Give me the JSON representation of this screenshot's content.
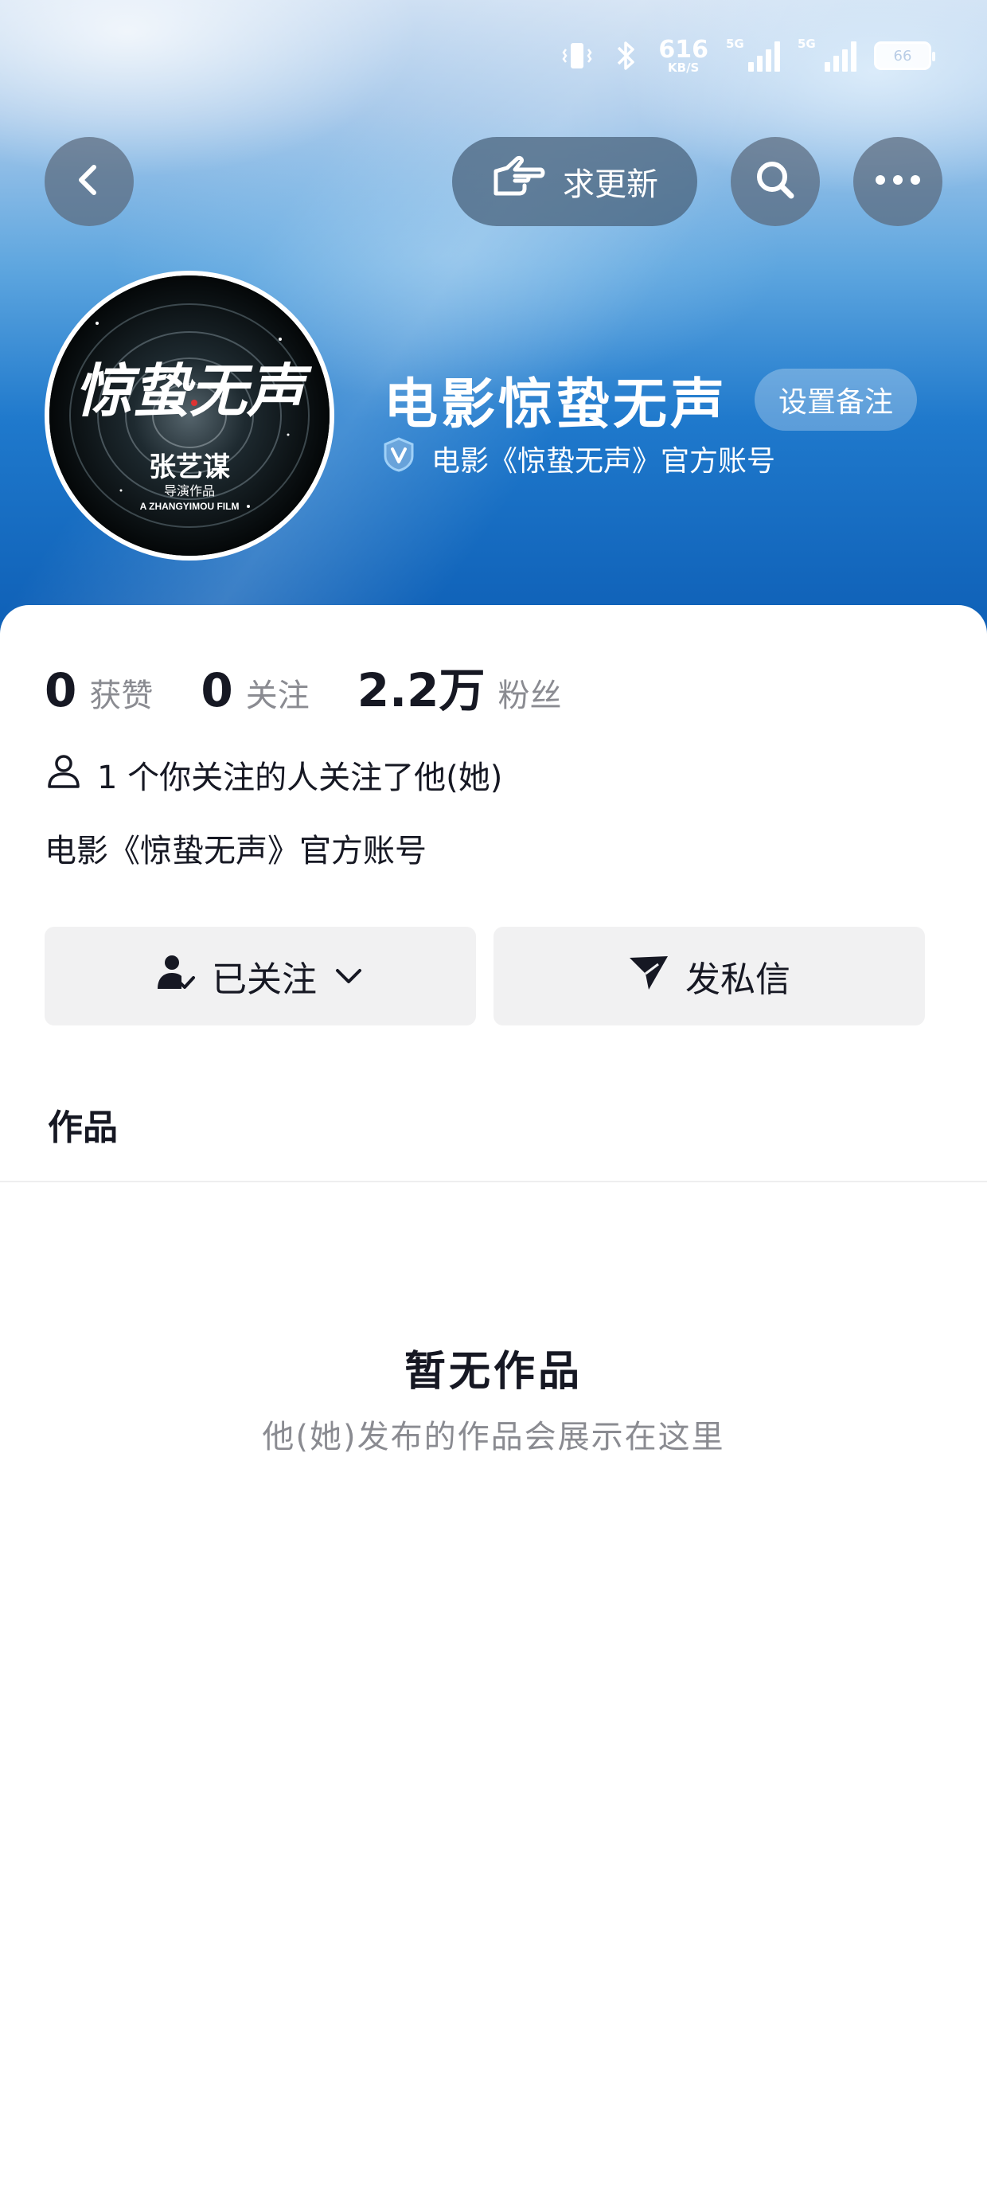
{
  "status_bar": {
    "net_speed": "616",
    "net_unit": "KB/S",
    "sim1_label": "5G",
    "sim2_label": "5G",
    "battery": "66"
  },
  "nav": {
    "back_icon": "chevron-left-icon",
    "request_update_label": "求更新",
    "request_update_icon": "pointing-hand-icon",
    "search_icon": "search-icon",
    "more_icon": "more-dots-icon"
  },
  "profile": {
    "name": "电影惊蛰无声",
    "remark_button": "设置备注",
    "verified_text": "电影《惊蛰无声》官方账号",
    "avatar_texts": {
      "title": "惊蛰无声",
      "director": "张艺谋",
      "sub": "导演作品",
      "en": "A ZHANGYIMOU FILM"
    }
  },
  "stats": [
    {
      "value": "0",
      "label": "获赞"
    },
    {
      "value": "0",
      "label": "关注"
    },
    {
      "value": "2.2万",
      "label": "粉丝"
    }
  ],
  "mutual_follow": "1 个你关注的人关注了他(她)",
  "bio": "电影《惊蛰无声》官方账号",
  "actions": {
    "followed_label": "已关注",
    "message_label": "发私信"
  },
  "tabs": {
    "works": "作品"
  },
  "empty_state": {
    "title": "暂无作品",
    "subtitle": "他(她)发布的作品会展示在这里"
  },
  "colors": {
    "text_primary": "#161823",
    "text_secondary": "#8a8b91",
    "button_bg": "#f1f1f2",
    "banner_blue": "#1f79cc"
  }
}
